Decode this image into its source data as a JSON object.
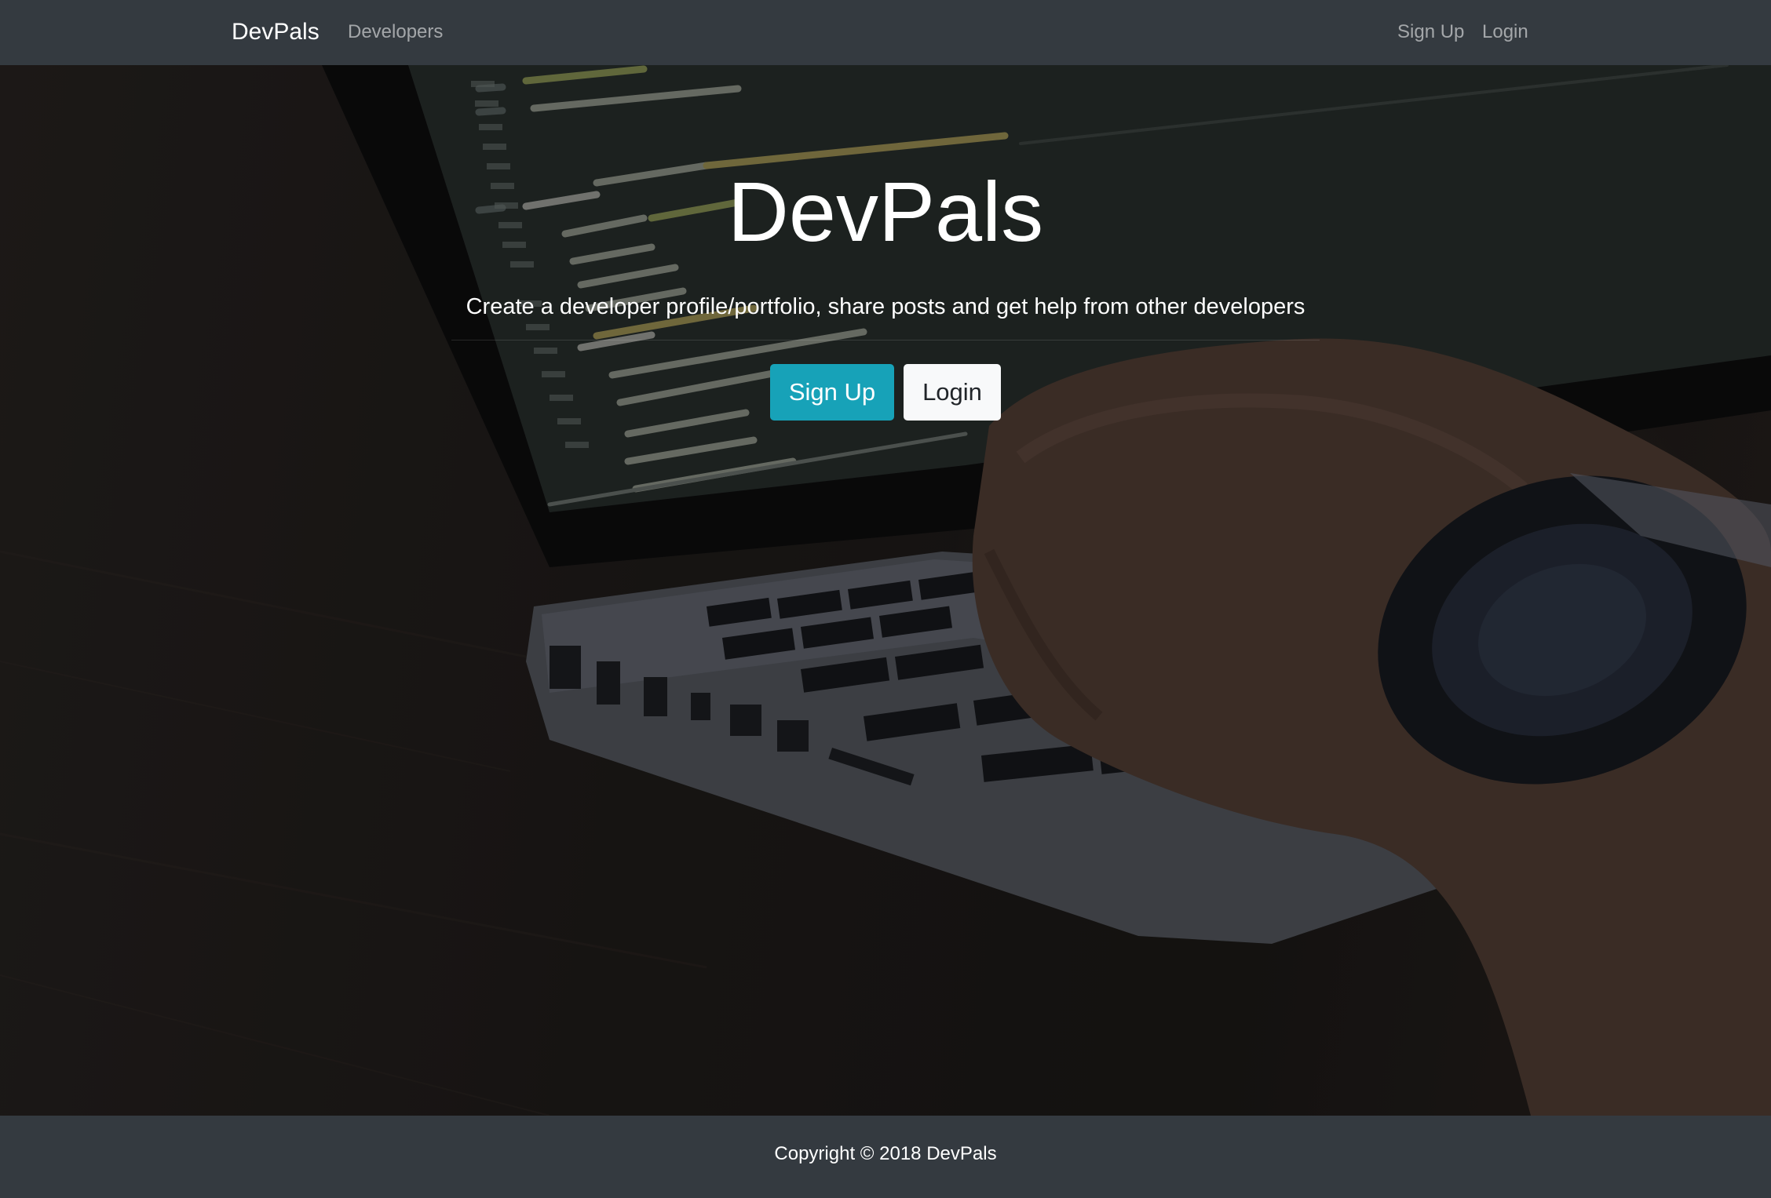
{
  "navbar": {
    "brand": "DevPals",
    "links_left": [
      "Developers"
    ],
    "links_right": [
      "Sign Up",
      "Login"
    ]
  },
  "landing": {
    "title": "DevPals",
    "lead": "Create a developer profile/portfolio, share posts and get help from other developers",
    "buttons": {
      "signup": "Sign Up",
      "login": "Login"
    }
  },
  "footer": {
    "copyright": "Copyright © 2018 DevPals"
  },
  "colors": {
    "navbar_bg": "#343a40",
    "signup_button": "#17a2b8",
    "login_button": "#f8f9fa",
    "text_light": "#ffffff"
  }
}
